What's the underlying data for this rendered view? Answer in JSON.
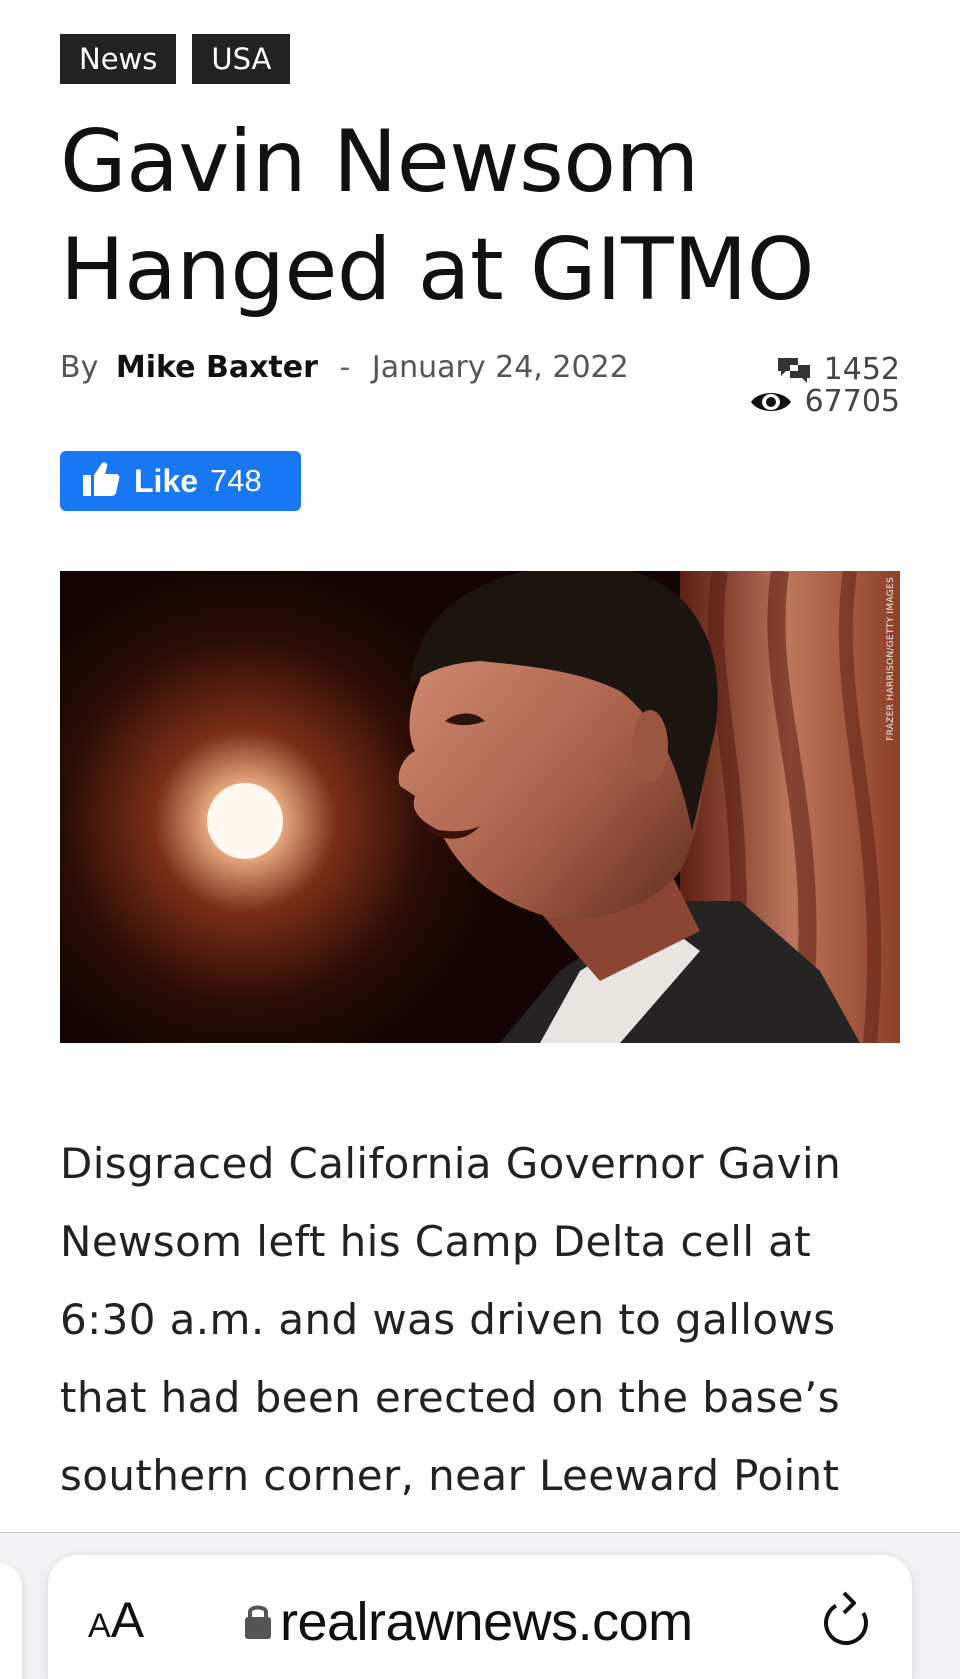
{
  "tags": [
    "News",
    "USA"
  ],
  "article": {
    "title": "Gavin Newsom Hanged at GITMO",
    "by_label": "By",
    "author": "Mike Baxter",
    "separator": "-",
    "date": "January 24, 2022",
    "comments_count": "1452",
    "views_count": "67705",
    "photo_credit": "FRAZER HARRISON/GETTY IMAGES",
    "body": "Disgraced California Governor Gavin Newsom left his Camp Delta cell at 6:30 a.m. and was driven to gallows that had been erected on the base’s southern corner, near Leeward Point"
  },
  "like_button": {
    "label": "Like",
    "count": "748",
    "icon": "thumbs-up-icon",
    "color": "#1877f2"
  },
  "browser": {
    "text_size_small": "A",
    "text_size_big": "A",
    "url": "realrawnews.com",
    "lock_icon": "lock-icon",
    "reload_icon": "reload-icon"
  },
  "colors": {
    "tag_bg": "#222222",
    "like_blue": "#1877f2"
  }
}
